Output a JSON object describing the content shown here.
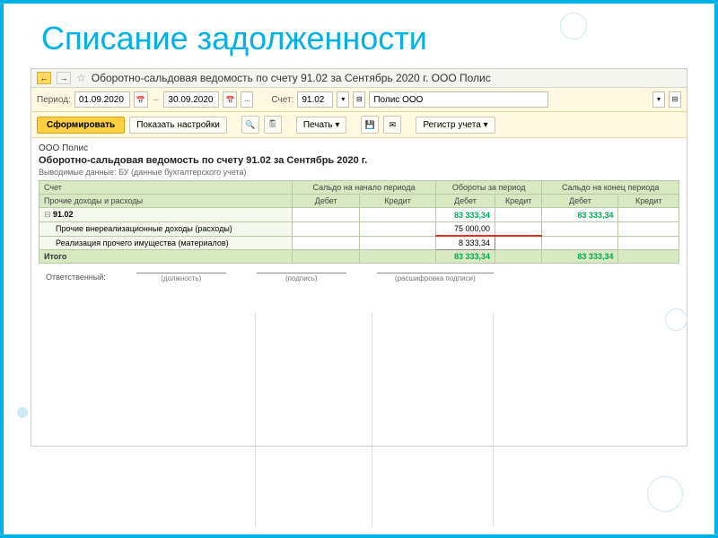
{
  "slide": {
    "title": "Списание задолженности"
  },
  "header": {
    "title": "Оборотно-сальдовая ведомость по счету 91.02 за Сентябрь 2020 г. ООО Полис"
  },
  "toolbar": {
    "period_label": "Период:",
    "date_from": "01.09.2020",
    "date_to": "30.09.2020",
    "dash": "–",
    "dots": "...",
    "account_label": "Счет:",
    "account": "91.02",
    "org": "Полис ООО"
  },
  "buttons": {
    "form": "Сформировать",
    "show_settings": "Показать настройки",
    "print": "Печать",
    "register": "Регистр учета"
  },
  "report": {
    "company": "ООО Полис",
    "title": "Оборотно-сальдовая ведомость по счету 91.02 за Сентябрь 2020 г.",
    "subtitle": "Выводимые данные: БУ (данные бухгалтерского учета)"
  },
  "columns": {
    "account": "Счет",
    "subaccount": "Прочие доходы и расходы",
    "bal_start": "Сальдо на начало периода",
    "turnover": "Обороты за период",
    "bal_end": "Сальдо на конец периода",
    "debit": "Дебет",
    "credit": "Кредит"
  },
  "rows": {
    "r1": {
      "name": "91.02",
      "turn_debit": "83 333,34",
      "end_debit": "83 333,34"
    },
    "r2": {
      "name": "Прочие внереализационные доходы (расходы)",
      "turn_debit": "75 000,00"
    },
    "r3": {
      "name": "Реализация прочего имущества (материалов)",
      "turn_debit": "8 333,34"
    },
    "total": {
      "name": "Итого",
      "turn_debit": "83 333,34",
      "end_debit": "83 333,34"
    }
  },
  "sign": {
    "resp": "Ответственный:",
    "position": "(должность)",
    "signature": "(подпись)",
    "decipher": "(расшифровка подписи)"
  }
}
